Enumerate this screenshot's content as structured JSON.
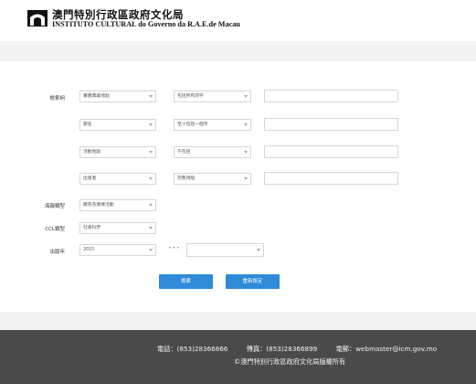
{
  "header": {
    "title_cn": "澳門特別行政區政府文化局",
    "title_en": "INSTITUTO CULTURAL do Governo da R.A.E.de Macau"
  },
  "form": {
    "keyword_label": "檢索詞",
    "rows": [
      {
        "field": "實體典藏地點",
        "operator": "包括所有的字"
      },
      {
        "field": "題名",
        "operator": "至少包括一個字"
      },
      {
        "field": "活動地點",
        "operator": "不包括"
      },
      {
        "field": "出版者",
        "operator": "完整詞組"
      }
    ],
    "category_label": "海報類型",
    "category_value": "體育及康樂活動",
    "ccl_label": "CCL類型",
    "ccl_value": "社會科學",
    "year_label": "出版年",
    "year_from": "2015",
    "year_separator": "•••",
    "year_to": "",
    "search_button": "檢索",
    "reset_button": "重新設定"
  },
  "footer": {
    "phone": "電話：(853)28366866",
    "fax": "傳真：(853)28366899",
    "email": "電郵：webmaster@icm.gov.mo",
    "copyright": "©澳門特別行政區政府文化局版權所有"
  }
}
